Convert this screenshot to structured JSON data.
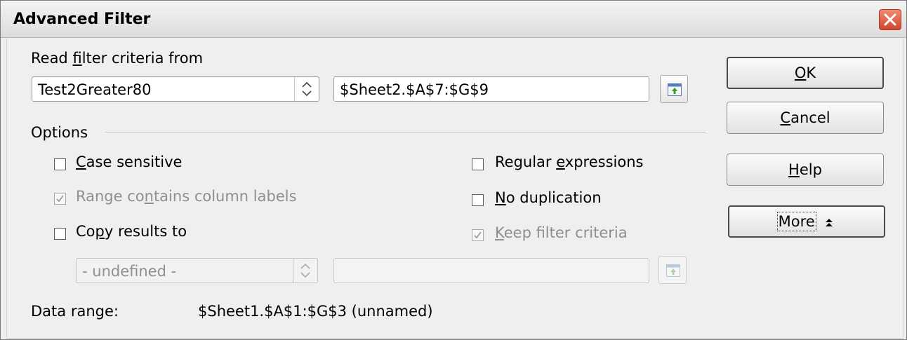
{
  "window": {
    "title": "Advanced Filter",
    "close_icon": "close-icon"
  },
  "criteria": {
    "group_label_pre": "Read ",
    "group_label_accel": "f",
    "group_label_post": "ilter criteria from",
    "named_range_value": "Test2Greater80",
    "range_value": "$Sheet2.$A$7:$G$9",
    "shrink_icon": "shrink-range-icon"
  },
  "options": {
    "label": "Options",
    "case_sensitive": {
      "accel": "C",
      "rest": "ase sensitive",
      "checked": false,
      "enabled": true
    },
    "range_contains_labels": {
      "pre": "Range co",
      "accel": "n",
      "post": "tains column labels",
      "checked": true,
      "enabled": false
    },
    "copy_results": {
      "pre": "Co",
      "accel": "p",
      "post": "y results to",
      "checked": false,
      "enabled": true
    },
    "regular_expressions": {
      "pre": "Regular ",
      "accel": "e",
      "post": "xpressions",
      "checked": false,
      "enabled": true
    },
    "no_duplication": {
      "accel": "N",
      "rest": "o duplication",
      "checked": false,
      "enabled": true
    },
    "keep_filter": {
      "accel": "K",
      "rest": "eep filter criteria",
      "checked": true,
      "enabled": false
    },
    "copy_target_select": "- undefined -",
    "copy_target_input": ""
  },
  "data_range": {
    "label": "Data range:",
    "value": "$Sheet1.$A$1:$G$3 (unnamed)"
  },
  "buttons": {
    "ok": {
      "accel": "O",
      "rest": "K"
    },
    "cancel": {
      "accel": "C",
      "rest": "ancel"
    },
    "help": {
      "accel": "H",
      "rest": "elp"
    },
    "more": {
      "label": "More",
      "icon": "collapse-up-icon"
    }
  }
}
